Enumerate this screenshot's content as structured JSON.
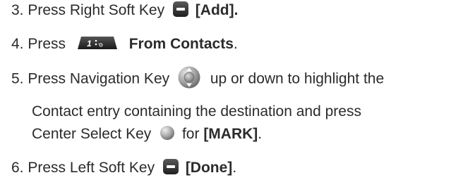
{
  "steps": [
    {
      "number": "3.",
      "text_before": "Press Right Soft Key",
      "key_icon": "right-soft-key-icon",
      "bold_label": "[Add]."
    },
    {
      "number": "4.",
      "text_before": "Press",
      "key_icon": "keypad-1-key-icon",
      "bold_label": "From Contacts",
      "text_after": "."
    },
    {
      "number": "5.",
      "text_before": "Press Navigation Key",
      "key_icon": "navigation-key-icon",
      "text_after": "up or down to highlight the",
      "line2": "Contact entry containing the destination and press",
      "line3_before": "Center Select Key",
      "key_icon_2": "center-select-key-icon",
      "line3_mid": "for",
      "bold_label": "[MARK]",
      "line3_after": "."
    },
    {
      "number": "6.",
      "text_before": "Press Left Soft Key",
      "key_icon": "left-soft-key-icon",
      "bold_label": "[Done]",
      "text_after": "."
    }
  ]
}
